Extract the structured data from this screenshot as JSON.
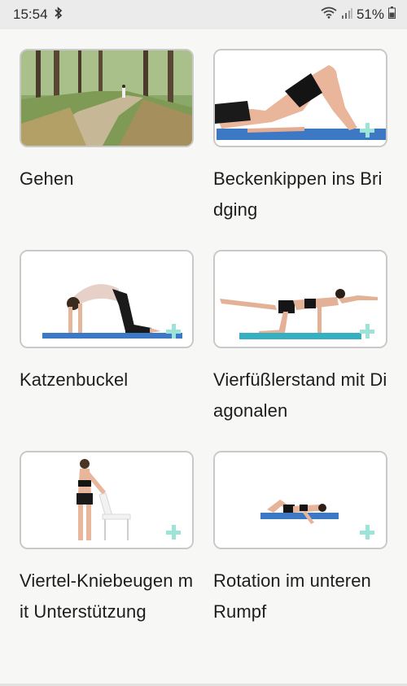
{
  "status_bar": {
    "time": "15:54",
    "battery": "51%"
  },
  "exercises": [
    {
      "title": "Gehen"
    },
    {
      "title": "Beckenkippen ins Bridging"
    },
    {
      "title": "Katzenbuckel"
    },
    {
      "title": "Vierfüßlerstand mit Diagonalen"
    },
    {
      "title": "Viertel-Kniebeugen mit Unterstützung"
    },
    {
      "title": "Rotation im unteren Rumpf"
    }
  ],
  "colors": {
    "accent_plus": "#9ee3d8",
    "mat": "#3c78c4",
    "card_border": "#c9c9c9"
  },
  "icons": [
    "bluetooth-icon",
    "wifi-icon",
    "signal-icon",
    "battery-icon",
    "add-icon"
  ]
}
